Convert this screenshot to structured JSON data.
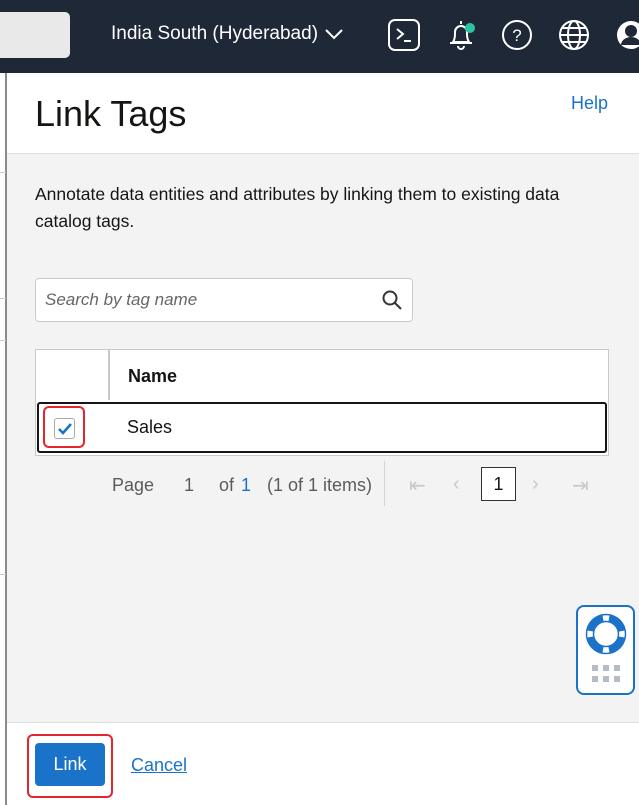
{
  "topbar": {
    "region": "India South (Hyderabad)",
    "notification_color": "#2bc4a1"
  },
  "panel": {
    "title": "Link Tags",
    "help_label": "Help",
    "description": "Annotate data entities and attributes by linking them to existing data catalog tags.",
    "search": {
      "placeholder": "Search by tag name",
      "value": ""
    },
    "table": {
      "columns": [
        "Name"
      ],
      "rows": [
        {
          "name": "Sales",
          "checked": true
        }
      ]
    },
    "pagination": {
      "page_label": "Page",
      "page": "1",
      "of_label": "of",
      "total_pages": "1",
      "items_text": "(1 of 1 items)",
      "current_page_button": "1"
    },
    "footer": {
      "link_label": "Link",
      "cancel_label": "Cancel"
    }
  },
  "colors": {
    "accent": "#1a73c8",
    "topbar": "#1f2836",
    "highlight": "#e3262c"
  }
}
